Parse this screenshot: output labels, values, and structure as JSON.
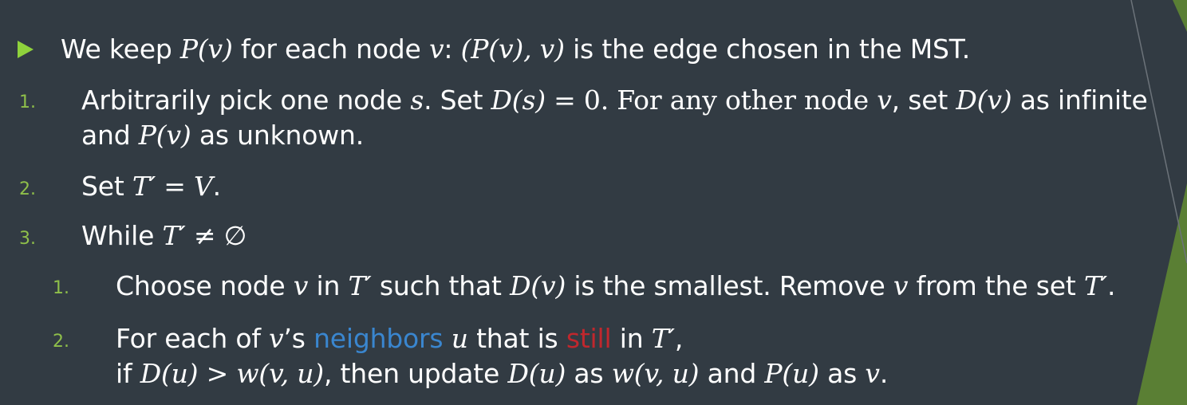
{
  "slide": {
    "bullet": {
      "t1": "We keep ",
      "m1": "P(v)",
      "t2": " for each node ",
      "m2": "v",
      "t3": ": ",
      "m3": "(P(v), v)",
      "t4": " is the edge chosen in the MST."
    },
    "steps": [
      {
        "number": "1.",
        "line1": {
          "t1": "Arbitrarily pick one node ",
          "m1": "s",
          "t2": ". Set ",
          "m2": "D(s)",
          "t3": " = 0. For any other node ",
          "m3": "v",
          "t4": ", set ",
          "m4": "D(v)",
          "t5": " as infinite"
        },
        "line2": {
          "t1": "and ",
          "m1": "P(v)",
          "t2": " as unknown."
        }
      },
      {
        "number": "2.",
        "t1": "Set ",
        "m1": "T′",
        "t2": " = ",
        "m2": "V",
        "t3": "."
      },
      {
        "number": "3.",
        "t1": "While ",
        "m1": "T′",
        "t2": " ≠ ∅"
      }
    ],
    "substeps": [
      {
        "number": "1.",
        "t1": "Choose node ",
        "m1": "v",
        "t2": " in ",
        "m2": "T′",
        "t3": " such that ",
        "m3": "D(v)",
        "t4": " is the smallest. Remove ",
        "m4": "v",
        "t5": " from the set ",
        "m5": "T′",
        "t6": "."
      },
      {
        "number": "2.",
        "line1": {
          "t1": "For each of ",
          "m1": "v",
          "t2": "’s ",
          "blue": "neighbors",
          "t3": " ",
          "m2": "u",
          "t4": " that is ",
          "red": "still",
          "t5": " in ",
          "m3": "T′",
          "t6": ","
        },
        "line2": {
          "t1": "if ",
          "m1": "D(u) > w(v, u)",
          "t2": ", then update ",
          "m2": "D(u)",
          "t3": " as ",
          "m3": "w(v, u)",
          "t4": " and ",
          "m4": "P(u)",
          "t5": " as ",
          "m5": "v",
          "t6": "."
        }
      }
    ]
  },
  "colors": {
    "background": "#323b43",
    "bullet": "#8fd23c",
    "numbers": "#8fbf4a",
    "highlight_blue": "#3a86cf",
    "highlight_red": "#c0272d",
    "corner_green": "#5a7f34"
  }
}
